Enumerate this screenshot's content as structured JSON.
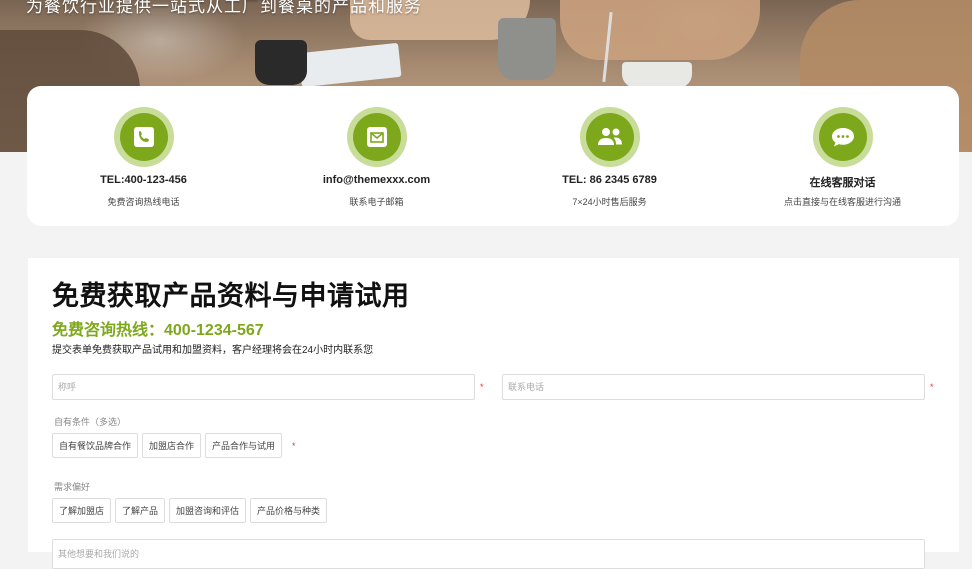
{
  "hero": {
    "tagline": "为餐饮行业提供一站式从工厂到餐桌的产品和服务"
  },
  "contacts": [
    {
      "icon": "phone-icon",
      "title": "TEL:400-123-456",
      "subtitle": "免费咨询热线电话"
    },
    {
      "icon": "envelope-icon",
      "title": "info@themexxx.com",
      "subtitle": "联系电子邮箱"
    },
    {
      "icon": "users-icon",
      "title": "TEL: 86 2345 6789",
      "subtitle": "7×24小时售后服务"
    },
    {
      "icon": "chat-icon",
      "title": "在线客服对话",
      "subtitle": "点击直接与在线客服进行沟通"
    }
  ],
  "form": {
    "title": "免费获取产品资料与申请试用",
    "hotline": "免费咨询热线：400-1234-567",
    "description": "提交表单免费获取产品试用和加盟资料，客户经理将会在24小时内联系您",
    "name_placeholder": "称呼",
    "phone_placeholder": "联系电话",
    "required_mark": "*",
    "conditions_label": "自有条件（多选）",
    "conditions": [
      "自有餐饮品牌合作",
      "加盟店合作",
      "产品合作与试用"
    ],
    "preference_label": "需求偏好",
    "preferences": [
      "了解加盟店",
      "了解产品",
      "加盟咨询和评估",
      "产品价格与种类"
    ],
    "message_placeholder": "其他想要和我们说的"
  },
  "colors": {
    "accent": "#7ea81b",
    "accent_light": "#c8dd9a",
    "required": "#e23b3b",
    "page_bg": "#f3f3f3"
  }
}
